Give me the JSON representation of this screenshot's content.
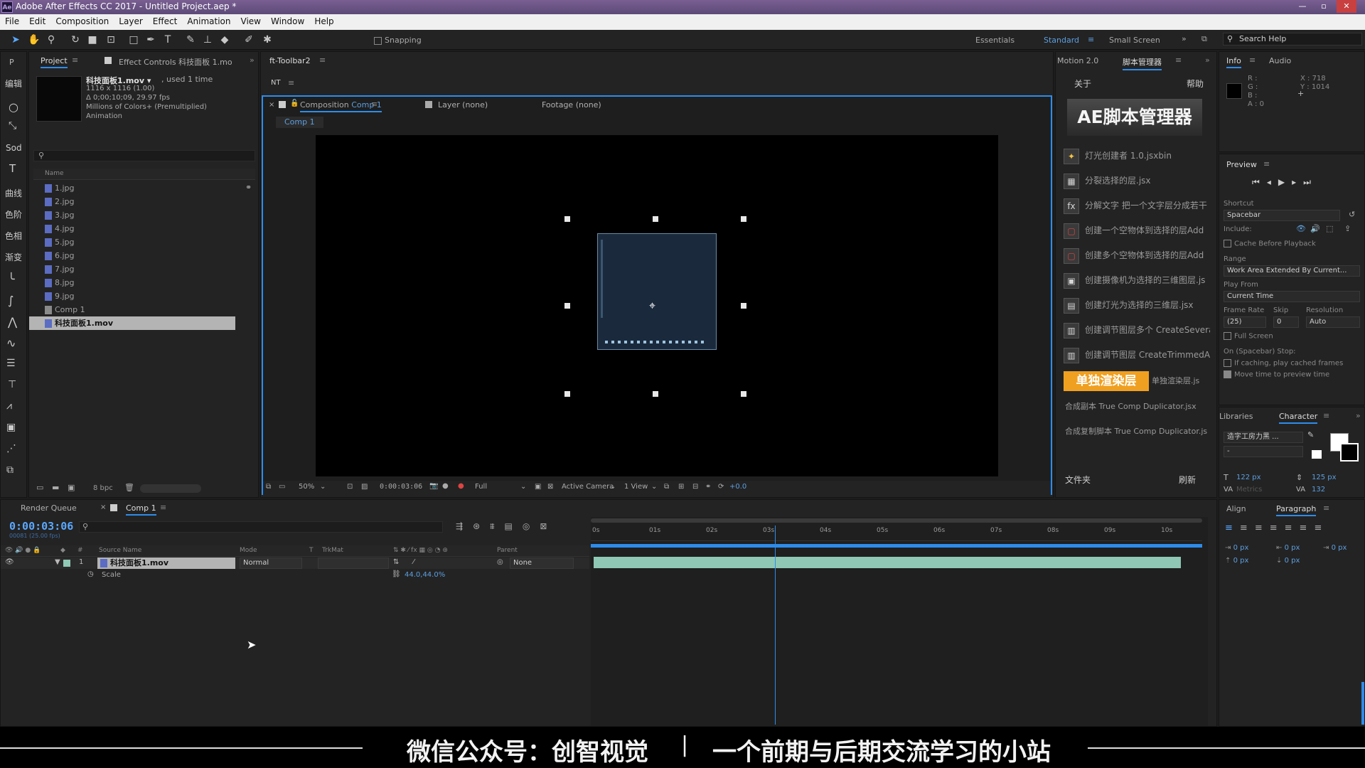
{
  "window": {
    "title": "Adobe After Effects CC 2017 - Untitled Project.aep *",
    "app_badge": "Ae"
  },
  "menu": [
    "File",
    "Edit",
    "Composition",
    "Layer",
    "Effect",
    "Animation",
    "View",
    "Window",
    "Help"
  ],
  "toolbar": {
    "snapping_label": "Snapping",
    "workspaces": [
      "Essentials",
      "Standard",
      "Small Screen"
    ],
    "active_workspace": "Standard",
    "search_help_placeholder": "Search Help"
  },
  "left_tools": [
    "P",
    "编辑",
    "",
    "",
    "Sod",
    "",
    "曲线",
    "色阶",
    "色相",
    "渐变"
  ],
  "project_panel": {
    "tab_project": "Project",
    "tab_effect_controls": "Effect Controls 科技面板 1.mo",
    "selected_name": "科技面板1.mov ▾",
    "used": ", used 1 time",
    "info_lines": [
      "1116 x 1116 (1.00)",
      "Δ 0;00;10;09, 29.97 fps",
      "Millions of Colors+ (Premultiplied)",
      "Animation"
    ],
    "search_placeholder": "",
    "column_name": "Name",
    "items": [
      "1.jpg",
      "2.jpg",
      "3.jpg",
      "4.jpg",
      "5.jpg",
      "6.jpg",
      "7.jpg",
      "8.jpg",
      "9.jpg",
      "Comp 1",
      "科技面板1.mov"
    ],
    "bpc": "8 bpc"
  },
  "ft_toolbar": {
    "tab": "ft-Toolbar2",
    "label": "NT"
  },
  "composition_panel": {
    "tab_prefix": "Composition",
    "tab_comp": "Comp 1",
    "tab_layer": "Layer (none)",
    "tab_footage": "Footage (none)",
    "breadcrumb": "Comp 1",
    "zoom": "50%",
    "timecode": "0:00:03:06",
    "resolution": "Full",
    "camera": "Active Camera",
    "views": "1 View",
    "exposure": "+0.0"
  },
  "script_panel": {
    "tab_motion": "Motion 2.0",
    "tab_script": "脚本管理器",
    "about": "关于",
    "help": "帮助",
    "banner": "AE脚本管理器",
    "scripts": [
      {
        "icon": "✦",
        "label": "灯光创建者 1.0.jsxbin"
      },
      {
        "icon": "▦",
        "label": "分裂选择的层.jsx"
      },
      {
        "icon": "fx",
        "label": "分解文字 把一个文字层分成若干"
      },
      {
        "icon": "▢",
        "label": "创建一个空物体到选择的层Add"
      },
      {
        "icon": "▢",
        "label": "创建多个空物体到选择的层Add"
      },
      {
        "icon": "▣",
        "label": "创建摄像机为选择的三维图层.js"
      },
      {
        "icon": "▤",
        "label": "创建灯光为选择的三维层.jsx"
      },
      {
        "icon": "▥",
        "label": "创建调节图层多个 CreateSeveral"
      },
      {
        "icon": "▥",
        "label": "创建调节图层 CreateTrimmedAdj"
      },
      {
        "icon": "",
        "label": "单独渲染层.js"
      },
      {
        "icon": "",
        "label": "合成副本 True Comp Duplicator.jsx"
      },
      {
        "icon": "",
        "label": "合成复制脚本 True Comp Duplicator.js"
      }
    ],
    "render_button": "单独渲染层",
    "folder": "文件夹",
    "refresh": "刷新"
  },
  "info_panel": {
    "tab_info": "Info",
    "tab_audio": "Audio",
    "rgba": [
      "R :",
      "G :",
      "B :",
      "A : 0"
    ],
    "x": "X : 718",
    "y": "Y : 1014"
  },
  "preview_panel": {
    "title": "Preview",
    "shortcut_label": "Shortcut",
    "shortcut_value": "Spacebar",
    "include_label": "Include:",
    "cache_label": "Cache Before Playback",
    "range_label": "Range",
    "range_value": "Work Area Extended By Current...",
    "play_from_label": "Play From",
    "play_from_value": "Current Time",
    "frame_rate_label": "Frame Rate",
    "skip_label": "Skip",
    "resolution_label": "Resolution",
    "frame_rate_value": "(25)",
    "skip_value": "0",
    "resolution_value": "Auto",
    "full_screen": "Full Screen",
    "on_stop": "On (Spacebar) Stop:",
    "if_caching": "If caching, play cached frames",
    "move_time": "Move time to preview time"
  },
  "character_panel": {
    "tab_libraries": "Libraries",
    "tab_character": "Character",
    "font": "造字工房力黑 ...",
    "style": "-",
    "size": "122 px",
    "leading": "125 px",
    "kerning": "Metrics",
    "tracking": "132"
  },
  "paragraph_panel": {
    "tab_align": "Align",
    "tab_paragraph": "Paragraph",
    "indents": [
      "0 px",
      "0 px",
      "0 px",
      "0 px",
      "0 px"
    ]
  },
  "timeline": {
    "tab_render_queue": "Render Queue",
    "tab_comp": "Comp 1",
    "timecode": "0:00:03:06",
    "frames_sub": "00081 (25.00 fps)",
    "columns": [
      "Source Name",
      "Mode",
      "T",
      "TrkMat",
      "Parent"
    ],
    "layer": {
      "index": "1",
      "name": "科技面板1.mov",
      "mode": "Normal",
      "parent": "None"
    },
    "property": {
      "name": "Scale",
      "value": "44.0,44.0%"
    },
    "ruler": [
      "0s",
      "01s",
      "02s",
      "03s",
      "04s",
      "05s",
      "06s",
      "07s",
      "08s",
      "09s",
      "10s"
    ],
    "playhead_seconds": 3.24
  },
  "subtitle": {
    "left": "微信公众号：创智视觉",
    "separator": "|",
    "right": "一个前期与后期交流学习的小站"
  },
  "colors": {
    "accent_blue": "#2d8ceb",
    "layer_bar": "#8fc8b4",
    "render_button_bg": "#f0a020"
  }
}
